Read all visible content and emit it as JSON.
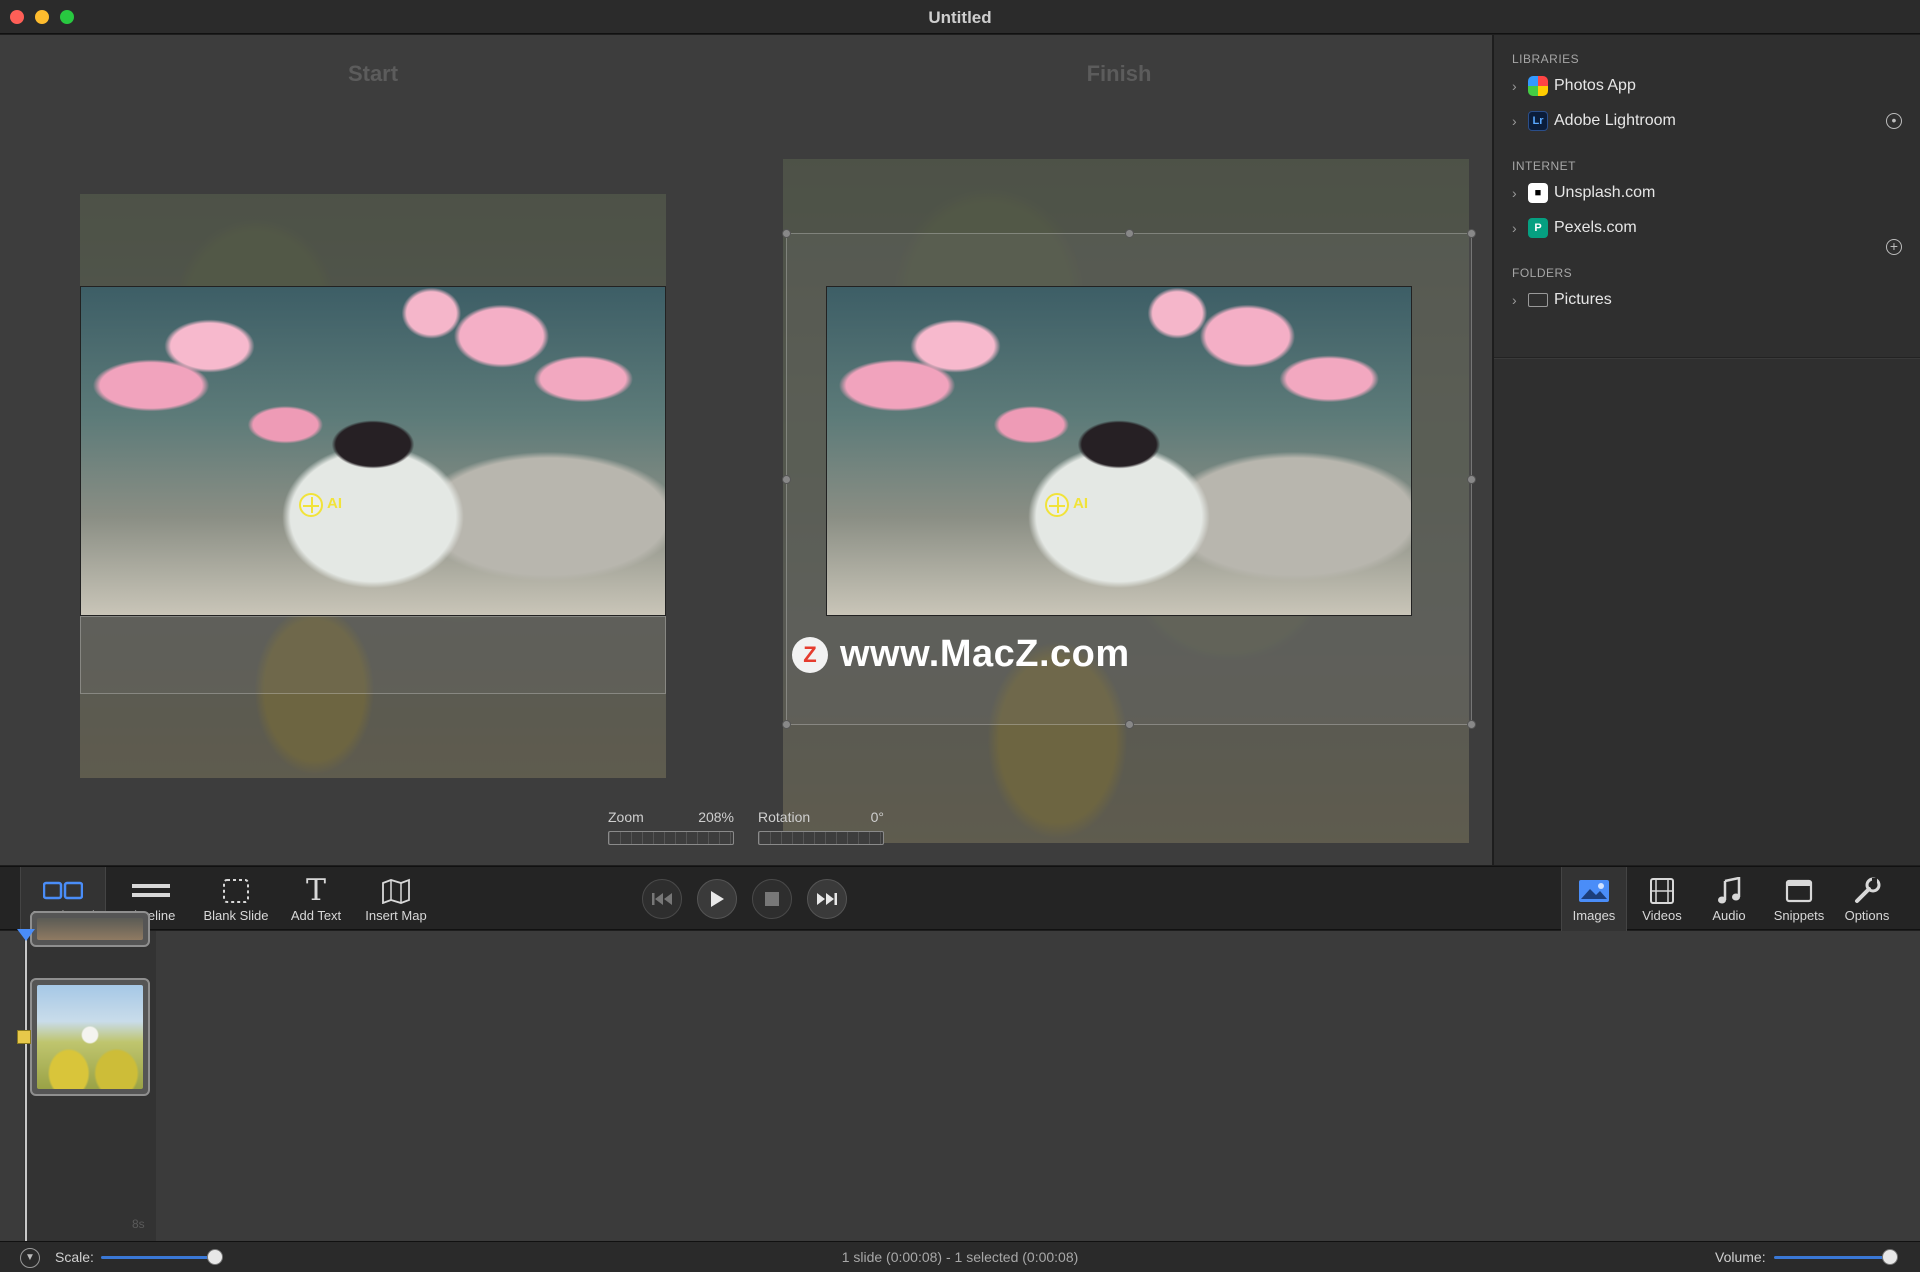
{
  "window": {
    "title": "Untitled"
  },
  "editor": {
    "start_label": "Start",
    "finish_label": "Finish",
    "focus_label": "AI",
    "watermark": {
      "logo": "Z",
      "text": "www.MacZ.com"
    },
    "zoom": {
      "label": "Zoom",
      "value": "208%"
    },
    "rotation": {
      "label": "Rotation",
      "value": "0°"
    }
  },
  "sidebar": {
    "libraries": {
      "heading": "LIBRARIES",
      "items": [
        {
          "label": "Photos App",
          "icon": "photos-app-icon"
        },
        {
          "label": "Adobe Lightroom",
          "icon": "lightroom-icon",
          "badge": "Lr"
        }
      ]
    },
    "internet": {
      "heading": "INTERNET",
      "items": [
        {
          "label": "Unsplash.com",
          "icon": "unsplash-icon"
        },
        {
          "label": "Pexels.com",
          "icon": "pexels-icon",
          "badge": "P"
        }
      ]
    },
    "folders": {
      "heading": "FOLDERS",
      "items": [
        {
          "label": "Pictures",
          "icon": "folder-icon"
        }
      ]
    }
  },
  "toolbar": {
    "left": [
      {
        "label": "Storyboard",
        "icon": "storyboard-icon",
        "active": true
      },
      {
        "label": "Timeline",
        "icon": "timeline-icon"
      },
      {
        "label": "Blank Slide",
        "icon": "blank-slide-icon"
      },
      {
        "label": "Add Text",
        "icon": "add-text-icon",
        "glyph": "T"
      },
      {
        "label": "Insert Map",
        "icon": "map-icon"
      }
    ],
    "transport": [
      "skip-back-icon",
      "play-icon",
      "stop-icon",
      "skip-forward-icon"
    ],
    "right": [
      {
        "label": "Images",
        "icon": "images-icon",
        "active": true
      },
      {
        "label": "Videos",
        "icon": "videos-icon"
      },
      {
        "label": "Audio",
        "icon": "audio-icon"
      },
      {
        "label": "Snippets",
        "icon": "snippets-icon"
      },
      {
        "label": "Options",
        "icon": "options-icon"
      }
    ]
  },
  "storyboard": {
    "duration": "8s"
  },
  "statusbar": {
    "scale_label": "Scale:",
    "status": "1 slide (0:00:08) - 1 selected (0:00:08)",
    "volume_label": "Volume:"
  },
  "colors": {
    "accent": "#3a78d6",
    "focus": "#f1e33a",
    "playhead": "#4a8df8"
  }
}
